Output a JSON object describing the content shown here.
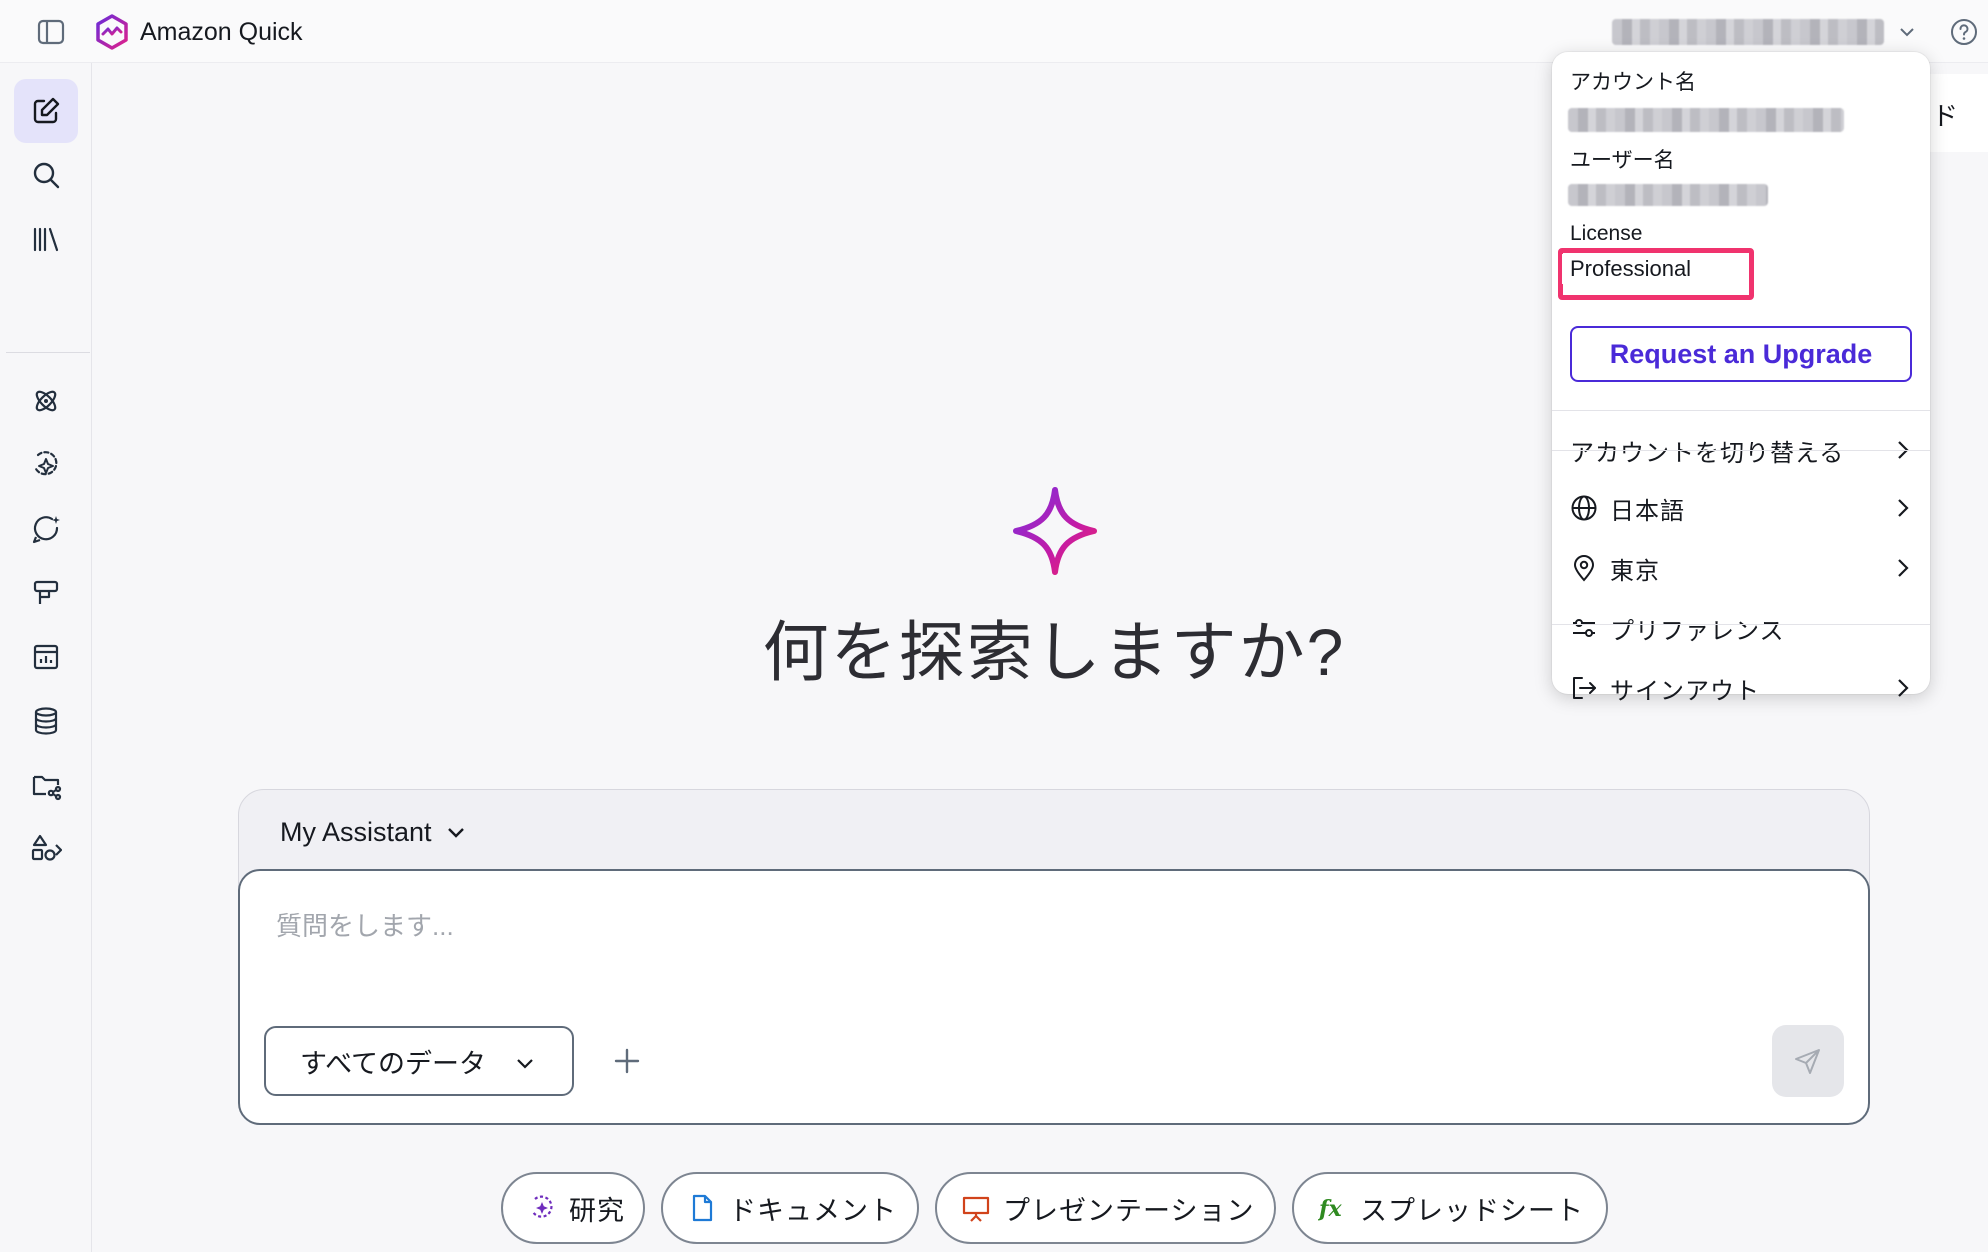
{
  "app": {
    "title": "Amazon Quick"
  },
  "hero": {
    "title": "何を探索しますか?"
  },
  "composer": {
    "assistant_label": "My Assistant",
    "prompt_placeholder": "質問をします...",
    "data_scope_label": "すべてのデータ"
  },
  "suggestions": [
    {
      "label": "研究",
      "icon": "research-sparkle-icon"
    },
    {
      "label": "ドキュメント",
      "icon": "document-icon"
    },
    {
      "label": "プレゼンテーション",
      "icon": "presentation-icon"
    },
    {
      "label": "スプレッドシート",
      "icon": "fx-icon"
    }
  ],
  "background_card": {
    "partial_text": "ド"
  },
  "account_menu": {
    "account_name_label": "アカウント名",
    "user_name_label": "ユーザー名",
    "license_label": "License",
    "license_value": "Professional",
    "upgrade_button": "Request an Upgrade",
    "items": [
      {
        "label": "アカウントを切り替える",
        "icon": ""
      },
      {
        "label": "日本語",
        "icon": "globe-icon"
      },
      {
        "label": "東京",
        "icon": "location-pin-icon"
      },
      {
        "label": "プリファレンス",
        "icon": "sliders-icon"
      },
      {
        "label": "サインアウト",
        "icon": "sign-out-icon"
      }
    ]
  },
  "colors": {
    "brand_purple": "#4a2ad8",
    "highlight_pink": "#f0336e",
    "active_rail_bg": "#e4e3fa"
  },
  "rail": [
    {
      "name": "new-chat",
      "icon": "pencil-square-icon",
      "active": true
    },
    {
      "name": "search",
      "icon": "search-icon"
    },
    {
      "name": "library",
      "icon": "library-icon"
    },
    {
      "name": "spaces",
      "icon": "atom-icon"
    },
    {
      "name": "agents",
      "icon": "sparkle-agent-icon"
    },
    {
      "name": "chat-agents",
      "icon": "chat-sparkle-icon"
    },
    {
      "name": "flows",
      "icon": "flow-icon"
    },
    {
      "name": "dashboards",
      "icon": "dashboard-icon"
    },
    {
      "name": "datasets",
      "icon": "database-icon"
    },
    {
      "name": "shared-folders",
      "icon": "shared-folder-icon"
    },
    {
      "name": "integrations",
      "icon": "shapes-icon"
    }
  ]
}
